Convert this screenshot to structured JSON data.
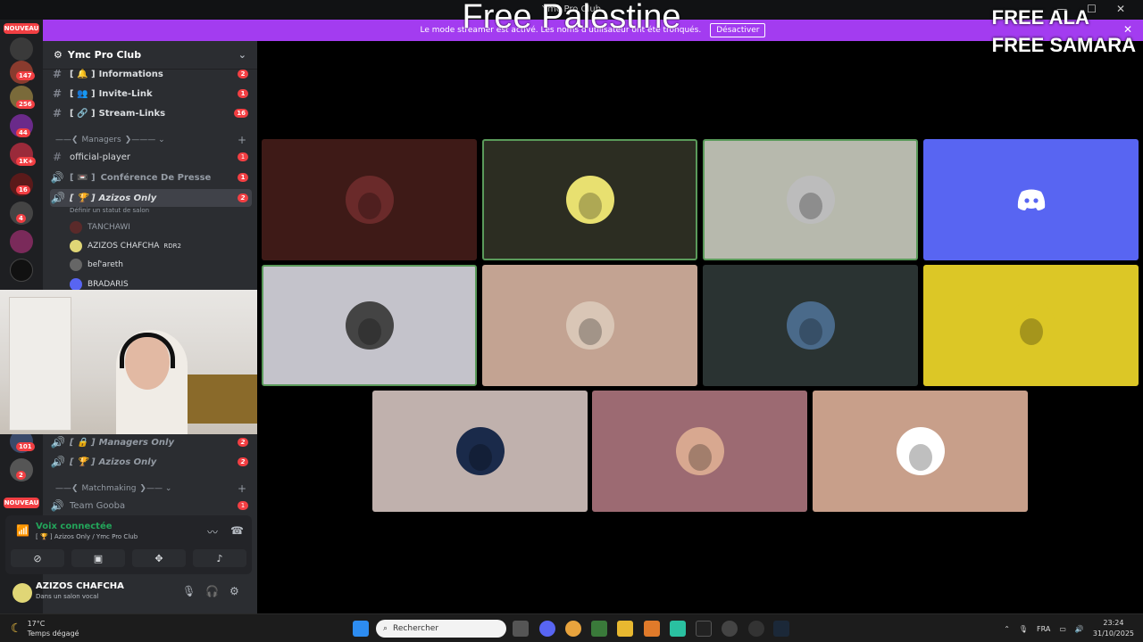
{
  "window": {
    "title": "Ymc Pro Club"
  },
  "streamer_bar": {
    "text": "Le mode streamer est activé. Les noms d'utilisateur ont été tronqués.",
    "button": "Désactiver"
  },
  "overlay": {
    "title": "Free Palestine",
    "right_line1": "FREE ALA",
    "right_line2": "FREE SAMARA"
  },
  "rail": {
    "nouveau_top": "NOUVEAU",
    "nouveau_bottom": "NOUVEAU",
    "badges": [
      "147",
      "256",
      "44",
      "1K+",
      "16",
      "4",
      "101",
      "2"
    ]
  },
  "server": {
    "name": "Ymc Pro Club"
  },
  "channels": [
    {
      "name": "Informations",
      "prefix": "[ 🔔 ]",
      "badge": "2"
    },
    {
      "name": "Invite-Link",
      "prefix": "[ 👥 ]",
      "badge": "1"
    },
    {
      "name": "Stream-Links",
      "prefix": "[ 🔗 ]",
      "badge": "16"
    }
  ],
  "category_managers": "Managers",
  "official_player": {
    "name": "official-player",
    "badge": "1"
  },
  "conference": {
    "name": "Conférence De Presse",
    "prefix": "[ 📼 ]",
    "badge": "1"
  },
  "azizos_only_active": {
    "name": "Azizos Only",
    "prefix": "[ 🏆 ]",
    "badge": "2",
    "status": "Définir un statut de salon"
  },
  "members": [
    {
      "name": "TANCHAWI",
      "tag": ""
    },
    {
      "name": "AZIZOS CHAFCHA",
      "tag": "RDR2"
    },
    {
      "name": "bel'̀areth",
      "tag": ""
    },
    {
      "name": "BRADARIS",
      "tag": ""
    }
  ],
  "managers_only": {
    "name": "Managers Only",
    "prefix": "[ 🔒 ]",
    "badge": "2"
  },
  "azizos_only_2": {
    "name": "Azizos Only",
    "prefix": "[ 🏆 ]",
    "badge": "2"
  },
  "category_matchmaking": "Matchmaking",
  "team_gooba": {
    "name": "Team Gooba",
    "badge": "1"
  },
  "voice": {
    "status": "Voix connectée",
    "channel": "[ 🏆 ] Azizos Only / Ymc Pro Club"
  },
  "user": {
    "name": "AZIZOS CHAFCHA",
    "status": "Dans un salon vocal"
  },
  "taskbar": {
    "weather_temp": "17°C",
    "weather_desc": "Temps dégagé",
    "search_placeholder": "Rechercher",
    "lang": "FRA",
    "time": "23:24",
    "date": "31/10/2025"
  },
  "colors": {
    "accent_streamer": "#a33cf0",
    "discord_blurple": "#5865f2",
    "speaking": "#5a9a5a",
    "badge_red": "#f23f43"
  },
  "tiles": [
    {
      "bg": "#3e1a17",
      "speaking": false,
      "avatar": "dark-red-photo"
    },
    {
      "bg": "#2c2d22",
      "speaking": true,
      "avatar": "yellow-cartoon"
    },
    {
      "bg": "#b7b9ad",
      "speaking": true,
      "avatar": "gray-hooded"
    },
    {
      "bg": "#5865f2",
      "speaking": false,
      "avatar": "discord-logo"
    },
    {
      "bg": "#c4c3cb",
      "speaking": true,
      "avatar": "anime-dark"
    },
    {
      "bg": "#c3a392",
      "speaking": false,
      "avatar": "man-white-shirt"
    },
    {
      "bg": "#2a3332",
      "speaking": false,
      "avatar": "football-pitch"
    },
    {
      "bg": "#dcc726",
      "speaking": false,
      "avatar": "yellow-cartoon-beard"
    },
    {
      "bg": "#c0b1ad",
      "speaking": false,
      "avatar": "player-blue-kit"
    },
    {
      "bg": "#9c6a72",
      "speaking": false,
      "avatar": "player-blond"
    },
    {
      "bg": "#c89f8a",
      "speaking": false,
      "avatar": "cartoon-mustache"
    }
  ]
}
